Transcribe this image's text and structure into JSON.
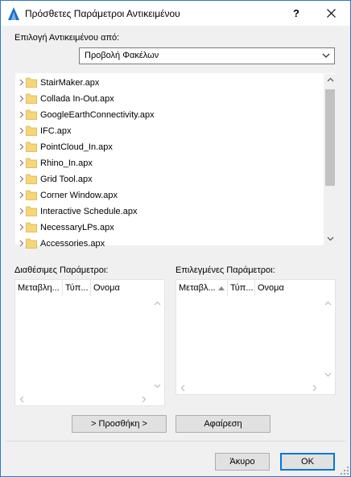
{
  "window": {
    "title": "Πρόσθετες Παράμετροι Αντικειμένου",
    "help_label": "?",
    "close_icon": "close-icon"
  },
  "source": {
    "label": "Επιλογή Αντικειμένου από:",
    "selected": "Προβολή Φακέλων"
  },
  "tree": {
    "items": [
      "StairMaker.apx",
      "Collada In-Out.apx",
      "GoogleEarthConnectivity.apx",
      "IFC.apx",
      "PointCloud_In.apx",
      "Rhino_In.apx",
      "Grid Tool.apx",
      "Corner Window.apx",
      "Interactive Schedule.apx",
      "NecessaryLPs.apx",
      "Accessories.apx"
    ]
  },
  "available": {
    "label": "Διαθέσιμες Παράμετροι:",
    "columns": [
      "Μεταβλη...",
      "Τύπ...",
      "Ονομα"
    ]
  },
  "chosen": {
    "label": "Επιλεγμένες Παράμετροι:",
    "columns": [
      "Μεταβλ...",
      "Τύπ...",
      "Ονομα"
    ]
  },
  "buttons": {
    "add": "> Προσθήκη >",
    "remove": "Αφαίρεση",
    "cancel": "Άκυρο",
    "ok": "OK"
  },
  "colors": {
    "accent": "#0078d7",
    "folder": "#f5d67a",
    "window_border": "#2b79c8"
  }
}
